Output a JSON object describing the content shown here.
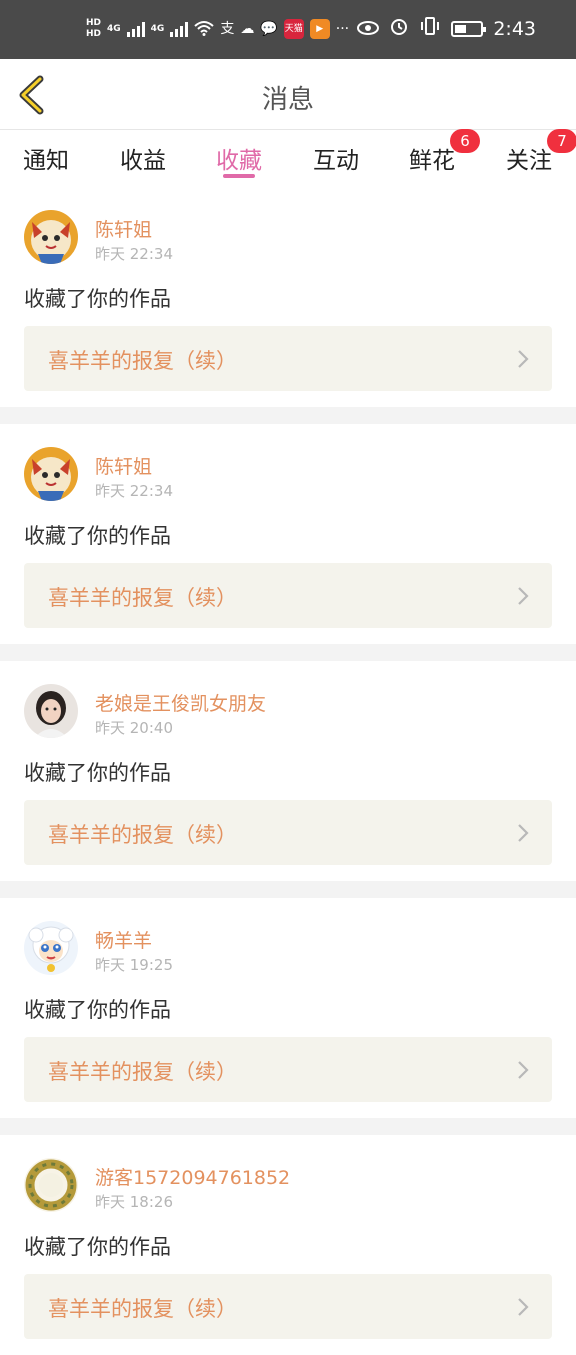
{
  "status_bar": {
    "hd1": "HD",
    "hd2": "HD",
    "net1": "4G",
    "net2": "4G",
    "alipay": "支",
    "app_red": "天猫",
    "more": "···",
    "time": "2:43"
  },
  "header": {
    "title": "消息",
    "back_icon": "chevron-left-icon"
  },
  "tabs": [
    {
      "label": "通知",
      "active": false,
      "badge": ""
    },
    {
      "label": "收益",
      "active": false,
      "badge": ""
    },
    {
      "label": "收藏",
      "active": true,
      "badge": ""
    },
    {
      "label": "互动",
      "active": false,
      "badge": ""
    },
    {
      "label": "鲜花",
      "active": false,
      "badge": "6"
    },
    {
      "label": "关注",
      "active": false,
      "badge": "7"
    }
  ],
  "messages": [
    {
      "username": "陈轩姐",
      "time": "昨天 22:34",
      "action": "收藏了你的作品",
      "work_title": "喜羊羊的报复（续）",
      "avatar": "cartoon-warrior"
    },
    {
      "username": "陈轩姐",
      "time": "昨天 22:34",
      "action": "收藏了你的作品",
      "work_title": "喜羊羊的报复（续）",
      "avatar": "cartoon-warrior"
    },
    {
      "username": "老娘是王俊凯女朋友",
      "time": "昨天 20:40",
      "action": "收藏了你的作品",
      "work_title": "喜羊羊的报复（续）",
      "avatar": "girl-photo"
    },
    {
      "username": "畅羊羊",
      "time": "昨天 19:25",
      "action": "收藏了你的作品",
      "work_title": "喜羊羊的报复（续）",
      "avatar": "cartoon-sheep"
    },
    {
      "username": "游客1572094761852",
      "time": "昨天 18:26",
      "action": "收藏了你的作品",
      "work_title": "喜羊羊的报复（续）",
      "avatar": "gold-wreath"
    }
  ],
  "colors": {
    "accent": "#e06aa8",
    "name": "#e3915f",
    "badge": "#f0303e",
    "status_bar": "#4a4a4a"
  }
}
